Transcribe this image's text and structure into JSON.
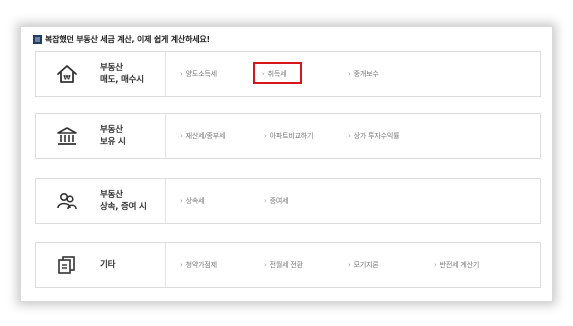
{
  "header": {
    "title": "복잡했던 부동산 세금 계산, 이제 쉽게 계산하세요!",
    "icon": "square-bullet-icon"
  },
  "rows": [
    {
      "title_line1": "부동산",
      "title_line2": "매도, 매수시",
      "icon": "house-won-icon",
      "links": [
        "양도소득세",
        "취득세",
        "중개보수"
      ]
    },
    {
      "title_line1": "부동산",
      "title_line2": "보유 시",
      "icon": "bank-building-icon",
      "links": [
        "재산세/종부세",
        "아파트비교하기",
        "상가 투자수익률"
      ]
    },
    {
      "title_line1": "부동산",
      "title_line2": "상속, 증여 시",
      "icon": "people-icon",
      "links": [
        "상속세",
        "증여세"
      ]
    },
    {
      "title_line1": "기타",
      "title_line2": "",
      "icon": "documents-icon",
      "links": [
        "청약가점제",
        "전월세 전환",
        "모기지론",
        "반전세 계산기"
      ]
    }
  ],
  "highlighted_link": "취득세",
  "colors": {
    "highlight": "#d6161c",
    "header_icon": "#1f3e64"
  }
}
